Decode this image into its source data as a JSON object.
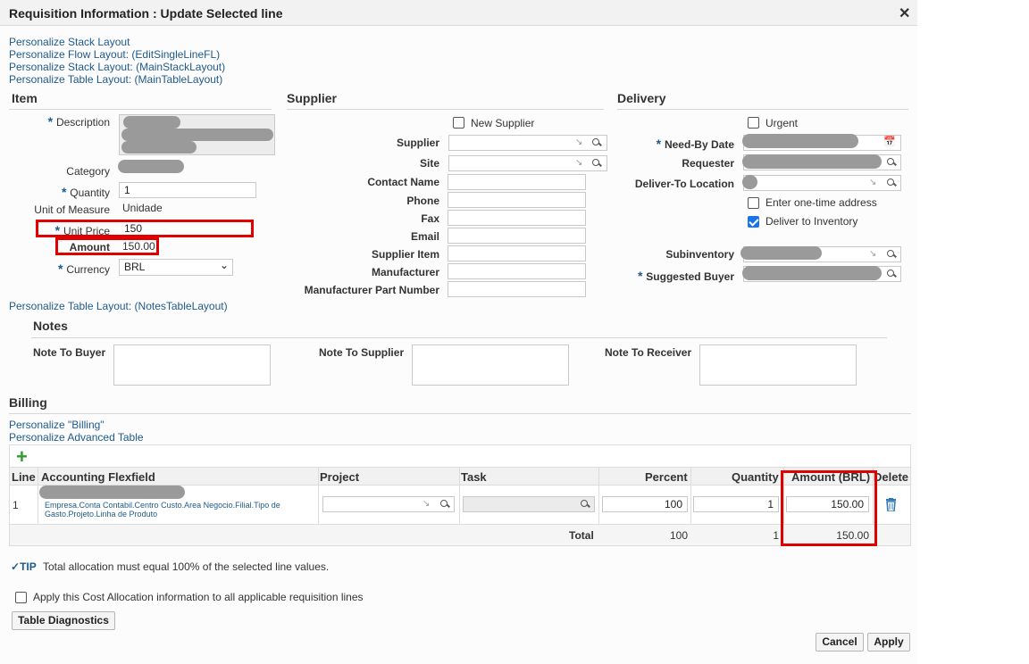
{
  "dialog": {
    "title": "Requisition Information : Update Selected line",
    "close": "✕"
  },
  "personalize": {
    "stack": "Personalize Stack Layout",
    "flow": "Personalize Flow Layout: (EditSingleLineFL)",
    "stack_main": "Personalize Stack Layout: (MainStackLayout)",
    "table_main": "Personalize Table Layout: (MainTableLayout)",
    "notes_table": "Personalize Table Layout: (NotesTableLayout)",
    "billing": "Personalize \"Billing\"",
    "advanced": "Personalize Advanced Table"
  },
  "item": {
    "heading": "Item",
    "description_label": "Description",
    "category_label": "Category",
    "quantity_label": "Quantity",
    "quantity_value": "1",
    "uom_label": "Unit of Measure",
    "uom_value": "Unidade",
    "unit_price_label": "Unit Price",
    "unit_price_value": "150",
    "amount_label": "Amount",
    "amount_value": "150.00",
    "currency_label": "Currency",
    "currency_value": "BRL"
  },
  "supplier": {
    "heading": "Supplier",
    "new_supplier": "New Supplier",
    "labels": [
      "Supplier",
      "Site",
      "Contact Name",
      "Phone",
      "Fax",
      "Email",
      "Supplier Item",
      "Manufacturer",
      "Manufacturer Part Number"
    ]
  },
  "delivery": {
    "heading": "Delivery",
    "urgent": "Urgent",
    "need_by": "Need-By Date",
    "requester": "Requester",
    "deliver_to": "Deliver-To Location",
    "one_time": "Enter one-time address",
    "deliver_inventory": "Deliver to Inventory",
    "subinventory": "Subinventory",
    "suggested_buyer": "Suggested Buyer"
  },
  "notes": {
    "heading": "Notes",
    "to_buyer": "Note To Buyer",
    "to_supplier": "Note To Supplier",
    "to_receiver": "Note To Receiver"
  },
  "billing": {
    "heading": "Billing",
    "columns": {
      "line": "Line",
      "acct": "Accounting Flexfield",
      "project": "Project",
      "task": "Task",
      "percent": "Percent",
      "quantity": "Quantity",
      "amount": "Amount (BRL)",
      "delete": "Delete"
    },
    "row": {
      "line": "1",
      "acct_desc": "Empresa.Conta Contabil.Centro Custo.Area Negocio.Filial.Tipo de Gasto.Projeto.Linha de Produto",
      "percent": "100",
      "quantity": "1",
      "amount": "150.00"
    },
    "total": {
      "label": "Total",
      "percent": "100",
      "quantity": "1",
      "amount": "150.00"
    }
  },
  "tip": {
    "label": "TIP",
    "text": "Total allocation must equal 100% of the selected line values."
  },
  "apply_all": "Apply this Cost Allocation information to all applicable requisition lines",
  "buttons": {
    "diagnostics": "Table Diagnostics",
    "cancel": "Cancel",
    "apply": "Apply"
  }
}
